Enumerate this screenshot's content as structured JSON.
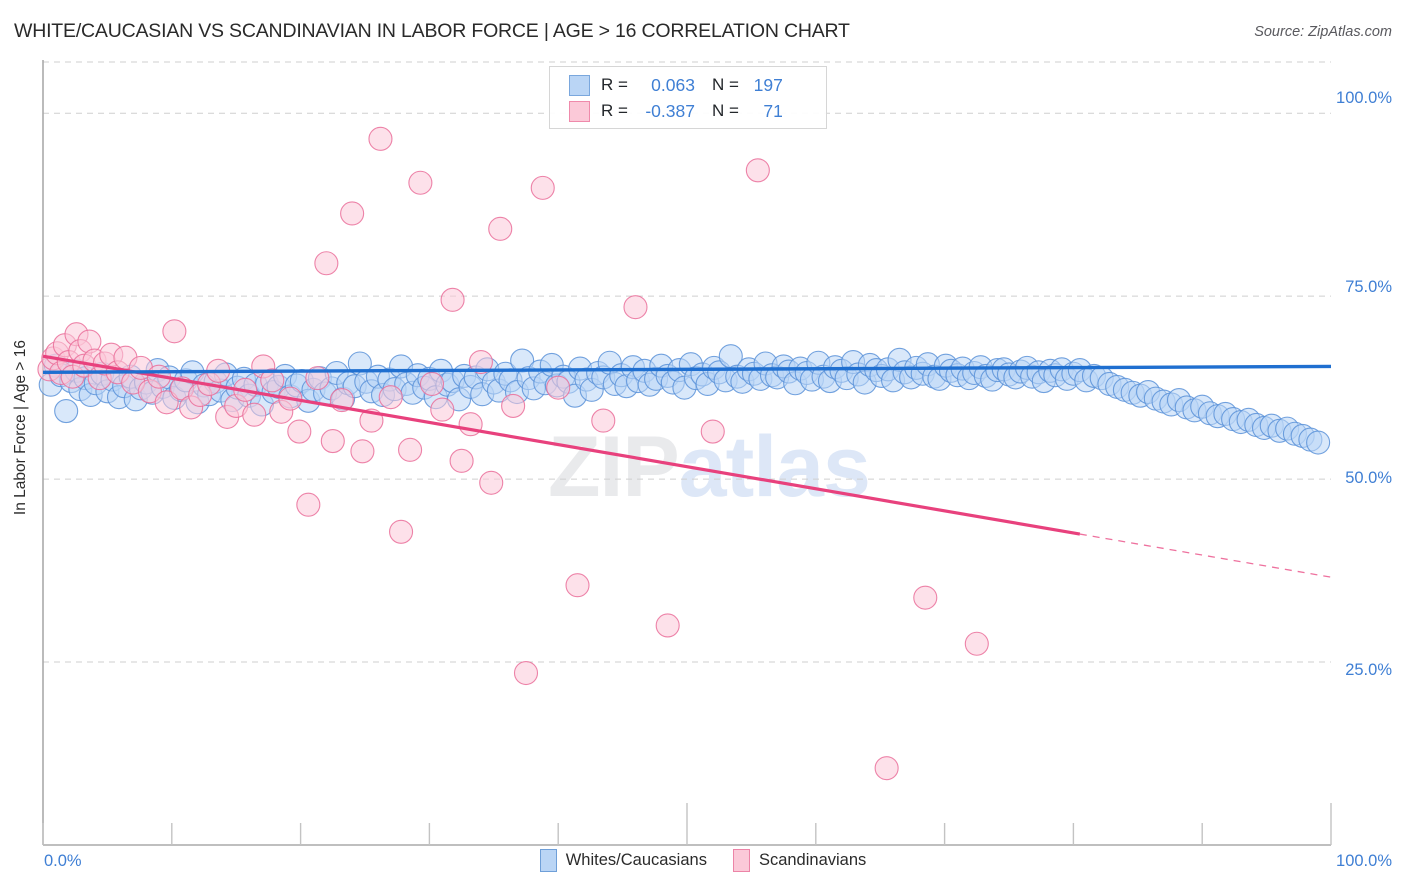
{
  "header": {
    "title": "WHITE/CAUCASIAN VS SCANDINAVIAN IN LABOR FORCE | AGE > 16 CORRELATION CHART",
    "source": "Source: ZipAtlas.com"
  },
  "watermark": {
    "part1": "ZIP",
    "part2": "atlas"
  },
  "stat_legend": {
    "rows": [
      {
        "series": "Whites/Caucasians",
        "color": "#bad5f5",
        "r_label": "R =",
        "r_value": "0.063",
        "n_label": "N =",
        "n_value": "197"
      },
      {
        "series": "Scandinavians",
        "color": "#fbc9d8",
        "r_label": "R =",
        "r_value": "-0.387",
        "n_label": "N =",
        "n_value": "71"
      }
    ]
  },
  "bottom_legend": {
    "items": [
      {
        "label": "Whites/Caucasians",
        "color": "#bad5f5"
      },
      {
        "label": "Scandinavians",
        "color": "#fbc9d8"
      }
    ]
  },
  "axes": {
    "y_title": "In Labor Force | Age > 16",
    "y_ticks": [
      "100.0%",
      "75.0%",
      "50.0%",
      "25.0%"
    ],
    "x_left": "0.0%",
    "x_right": "100.0%"
  },
  "chart_data": {
    "type": "scatter",
    "title": "WHITE/CAUCASIAN VS SCANDINAVIAN IN LABOR FORCE | AGE > 16 CORRELATION CHART",
    "xlabel": "",
    "ylabel": "In Labor Force | Age > 16",
    "xlim": [
      0,
      100
    ],
    "ylim": [
      0,
      107
    ],
    "grid": true,
    "legend_position": "bottom-center",
    "y_tick_values": [
      100,
      75,
      50,
      25
    ],
    "x_tick_values": [
      0,
      100
    ],
    "series": [
      {
        "name": "Whites/Caucasians",
        "color": "#bad5f5",
        "edge_color": "#5b92d8",
        "r": 0.063,
        "n": 197,
        "trend": {
          "type": "linear",
          "x0": 0,
          "y0": 64.6,
          "x1": 100,
          "y1": 65.4,
          "solid_to_x": 100
        },
        "points": [
          [
            0.6,
            62.9
          ],
          [
            1.0,
            65.5
          ],
          [
            1.4,
            64.2
          ],
          [
            1.8,
            59.3
          ],
          [
            2.2,
            63.4
          ],
          [
            2.6,
            64.8
          ],
          [
            2.9,
            62.3
          ],
          [
            3.3,
            63.8
          ],
          [
            3.7,
            61.5
          ],
          [
            4.1,
            63.1
          ],
          [
            4.6,
            64.4
          ],
          [
            5.0,
            62.0
          ],
          [
            5.4,
            63.6
          ],
          [
            5.9,
            61.2
          ],
          [
            6.3,
            62.7
          ],
          [
            6.8,
            64.0
          ],
          [
            7.2,
            60.9
          ],
          [
            7.6,
            62.4
          ],
          [
            8.0,
            63.2
          ],
          [
            8.5,
            61.8
          ],
          [
            8.9,
            64.9
          ],
          [
            9.3,
            62.6
          ],
          [
            9.8,
            63.9
          ],
          [
            10.2,
            61.1
          ],
          [
            10.7,
            62.2
          ],
          [
            11.1,
            63.5
          ],
          [
            11.6,
            64.6
          ],
          [
            12.0,
            60.5
          ],
          [
            12.5,
            62.8
          ],
          [
            12.9,
            61.6
          ],
          [
            13.4,
            63.3
          ],
          [
            13.8,
            62.1
          ],
          [
            14.2,
            64.3
          ],
          [
            14.7,
            60.8
          ],
          [
            15.1,
            62.5
          ],
          [
            15.6,
            63.7
          ],
          [
            16.0,
            61.4
          ],
          [
            16.5,
            62.9
          ],
          [
            17.0,
            60.2
          ],
          [
            17.4,
            63.0
          ],
          [
            17.9,
            61.9
          ],
          [
            18.3,
            62.6
          ],
          [
            18.8,
            64.1
          ],
          [
            19.2,
            61.3
          ],
          [
            19.7,
            62.8
          ],
          [
            20.1,
            63.4
          ],
          [
            20.6,
            60.7
          ],
          [
            21.0,
            62.2
          ],
          [
            21.5,
            63.8
          ],
          [
            21.9,
            61.7
          ],
          [
            22.4,
            62.4
          ],
          [
            22.8,
            64.5
          ],
          [
            23.3,
            61.0
          ],
          [
            23.7,
            63.1
          ],
          [
            24.2,
            62.7
          ],
          [
            24.6,
            65.8
          ],
          [
            25.1,
            63.3
          ],
          [
            25.5,
            62.0
          ],
          [
            26.0,
            64.0
          ],
          [
            26.4,
            61.5
          ],
          [
            26.9,
            63.6
          ],
          [
            27.3,
            62.3
          ],
          [
            27.8,
            65.4
          ],
          [
            28.2,
            63.0
          ],
          [
            28.7,
            61.8
          ],
          [
            29.1,
            64.2
          ],
          [
            29.6,
            62.5
          ],
          [
            30.0,
            63.7
          ],
          [
            30.5,
            61.2
          ],
          [
            30.9,
            64.8
          ],
          [
            31.4,
            62.9
          ],
          [
            31.8,
            63.4
          ],
          [
            32.3,
            60.9
          ],
          [
            32.7,
            64.1
          ],
          [
            33.2,
            62.6
          ],
          [
            33.6,
            63.9
          ],
          [
            34.1,
            61.6
          ],
          [
            34.5,
            65.0
          ],
          [
            35.0,
            63.2
          ],
          [
            35.4,
            62.1
          ],
          [
            35.9,
            64.4
          ],
          [
            36.3,
            63.5
          ],
          [
            36.8,
            61.9
          ],
          [
            37.2,
            66.2
          ],
          [
            37.7,
            63.8
          ],
          [
            38.1,
            62.4
          ],
          [
            38.6,
            64.7
          ],
          [
            39.0,
            63.1
          ],
          [
            39.5,
            65.6
          ],
          [
            39.9,
            62.8
          ],
          [
            40.4,
            64.0
          ],
          [
            40.8,
            63.3
          ],
          [
            41.3,
            61.4
          ],
          [
            41.7,
            65.1
          ],
          [
            42.2,
            63.6
          ],
          [
            42.6,
            62.2
          ],
          [
            43.1,
            64.5
          ],
          [
            43.5,
            63.9
          ],
          [
            44.0,
            65.9
          ],
          [
            44.4,
            63.0
          ],
          [
            44.9,
            64.2
          ],
          [
            45.3,
            62.7
          ],
          [
            45.8,
            65.3
          ],
          [
            46.2,
            63.4
          ],
          [
            46.7,
            64.8
          ],
          [
            47.1,
            62.9
          ],
          [
            47.6,
            63.7
          ],
          [
            48.0,
            65.5
          ],
          [
            48.5,
            64.1
          ],
          [
            48.9,
            63.2
          ],
          [
            49.4,
            64.9
          ],
          [
            49.8,
            62.5
          ],
          [
            50.3,
            65.7
          ],
          [
            50.7,
            63.8
          ],
          [
            51.2,
            64.3
          ],
          [
            51.6,
            63.0
          ],
          [
            52.1,
            65.2
          ],
          [
            52.5,
            64.6
          ],
          [
            53.0,
            63.5
          ],
          [
            53.4,
            66.8
          ],
          [
            53.9,
            64.0
          ],
          [
            54.3,
            63.3
          ],
          [
            54.8,
            65.0
          ],
          [
            55.2,
            64.4
          ],
          [
            55.7,
            63.7
          ],
          [
            56.1,
            65.8
          ],
          [
            56.6,
            64.2
          ],
          [
            57.0,
            63.9
          ],
          [
            57.5,
            65.4
          ],
          [
            57.9,
            64.7
          ],
          [
            58.4,
            63.1
          ],
          [
            58.8,
            65.1
          ],
          [
            59.3,
            64.5
          ],
          [
            59.7,
            63.6
          ],
          [
            60.2,
            65.9
          ],
          [
            60.6,
            64.0
          ],
          [
            61.1,
            63.4
          ],
          [
            61.5,
            65.3
          ],
          [
            62.0,
            64.8
          ],
          [
            62.4,
            63.8
          ],
          [
            62.9,
            66.0
          ],
          [
            63.3,
            64.3
          ],
          [
            63.8,
            63.2
          ],
          [
            64.2,
            65.6
          ],
          [
            64.7,
            64.9
          ],
          [
            65.1,
            64.1
          ],
          [
            65.6,
            65.0
          ],
          [
            66.0,
            63.5
          ],
          [
            66.5,
            66.3
          ],
          [
            66.9,
            64.6
          ],
          [
            67.4,
            63.9
          ],
          [
            67.8,
            65.2
          ],
          [
            68.3,
            64.4
          ],
          [
            68.7,
            65.7
          ],
          [
            69.2,
            64.0
          ],
          [
            69.6,
            63.7
          ],
          [
            70.1,
            65.5
          ],
          [
            70.5,
            64.8
          ],
          [
            71.0,
            64.2
          ],
          [
            71.4,
            65.1
          ],
          [
            71.9,
            63.8
          ],
          [
            72.3,
            64.5
          ],
          [
            72.8,
            65.3
          ],
          [
            73.2,
            64.1
          ],
          [
            73.7,
            63.6
          ],
          [
            74.1,
            64.9
          ],
          [
            74.6,
            65.0
          ],
          [
            75.0,
            64.3
          ],
          [
            75.5,
            63.9
          ],
          [
            75.9,
            64.7
          ],
          [
            76.4,
            65.2
          ],
          [
            76.8,
            64.0
          ],
          [
            77.3,
            64.6
          ],
          [
            77.7,
            63.4
          ],
          [
            78.2,
            64.8
          ],
          [
            78.6,
            64.2
          ],
          [
            79.1,
            65.0
          ],
          [
            79.5,
            63.7
          ],
          [
            80.0,
            64.4
          ],
          [
            80.5,
            64.9
          ],
          [
            81.0,
            63.5
          ],
          [
            81.6,
            64.1
          ],
          [
            82.2,
            63.8
          ],
          [
            82.8,
            63.0
          ],
          [
            83.4,
            62.6
          ],
          [
            84.0,
            62.2
          ],
          [
            84.6,
            61.8
          ],
          [
            85.2,
            61.4
          ],
          [
            85.8,
            61.9
          ],
          [
            86.4,
            61.0
          ],
          [
            87.0,
            60.6
          ],
          [
            87.6,
            60.2
          ],
          [
            88.2,
            60.8
          ],
          [
            88.8,
            59.8
          ],
          [
            89.4,
            59.4
          ],
          [
            90.0,
            59.9
          ],
          [
            90.6,
            59.0
          ],
          [
            91.2,
            58.6
          ],
          [
            91.8,
            58.9
          ],
          [
            92.4,
            58.2
          ],
          [
            93.0,
            57.8
          ],
          [
            93.6,
            58.1
          ],
          [
            94.2,
            57.4
          ],
          [
            94.8,
            57.0
          ],
          [
            95.4,
            57.3
          ],
          [
            96.0,
            56.6
          ],
          [
            96.6,
            56.9
          ],
          [
            97.2,
            56.2
          ],
          [
            97.8,
            55.9
          ],
          [
            98.4,
            55.4
          ],
          [
            99.0,
            55.0
          ]
        ]
      },
      {
        "name": "Scandinavians",
        "color": "#fbc9d8",
        "edge_color": "#ea6e9a",
        "r": -0.387,
        "n": 71,
        "trend": {
          "type": "linear",
          "x0": 0,
          "y0": 66.8,
          "x1": 100,
          "y1": 36.6,
          "solid_to_x": 80.5
        },
        "points": [
          [
            0.5,
            65.0
          ],
          [
            0.8,
            66.5
          ],
          [
            1.1,
            67.2
          ],
          [
            1.4,
            64.5
          ],
          [
            1.7,
            68.3
          ],
          [
            2.0,
            66.0
          ],
          [
            2.3,
            64.0
          ],
          [
            2.6,
            69.8
          ],
          [
            2.9,
            67.5
          ],
          [
            3.2,
            65.5
          ],
          [
            3.6,
            68.8
          ],
          [
            4.0,
            66.2
          ],
          [
            4.4,
            63.8
          ],
          [
            4.8,
            65.8
          ],
          [
            5.3,
            67.0
          ],
          [
            5.8,
            64.6
          ],
          [
            6.4,
            66.6
          ],
          [
            7.0,
            63.2
          ],
          [
            7.6,
            65.2
          ],
          [
            8.3,
            62.0
          ],
          [
            9.0,
            64.0
          ],
          [
            9.6,
            60.5
          ],
          [
            10.2,
            70.2
          ],
          [
            10.8,
            62.4
          ],
          [
            11.5,
            59.8
          ],
          [
            12.2,
            61.5
          ],
          [
            12.9,
            63.0
          ],
          [
            13.6,
            64.8
          ],
          [
            14.3,
            58.5
          ],
          [
            15.0,
            60.0
          ],
          [
            15.7,
            62.2
          ],
          [
            16.4,
            58.8
          ],
          [
            17.1,
            65.4
          ],
          [
            17.8,
            63.5
          ],
          [
            18.5,
            59.2
          ],
          [
            19.2,
            61.0
          ],
          [
            19.9,
            56.5
          ],
          [
            20.6,
            46.5
          ],
          [
            21.3,
            63.8
          ],
          [
            22.0,
            79.5
          ],
          [
            22.5,
            55.2
          ],
          [
            23.2,
            60.8
          ],
          [
            24.0,
            86.3
          ],
          [
            24.8,
            53.8
          ],
          [
            25.5,
            58.0
          ],
          [
            26.2,
            96.5
          ],
          [
            27.0,
            61.2
          ],
          [
            27.8,
            42.8
          ],
          [
            28.5,
            54.0
          ],
          [
            29.3,
            90.5
          ],
          [
            30.2,
            63.0
          ],
          [
            31.0,
            59.5
          ],
          [
            31.8,
            74.5
          ],
          [
            32.5,
            52.5
          ],
          [
            33.2,
            57.5
          ],
          [
            34.0,
            66.0
          ],
          [
            34.8,
            49.5
          ],
          [
            35.5,
            84.2
          ],
          [
            36.5,
            60.0
          ],
          [
            37.5,
            23.5
          ],
          [
            38.8,
            89.8
          ],
          [
            40.0,
            62.5
          ],
          [
            41.5,
            35.5
          ],
          [
            43.5,
            58.0
          ],
          [
            46.0,
            73.5
          ],
          [
            48.5,
            30.0
          ],
          [
            52.0,
            56.5
          ],
          [
            55.5,
            92.2
          ],
          [
            65.5,
            10.5
          ],
          [
            68.5,
            33.8
          ],
          [
            72.5,
            27.5
          ]
        ]
      }
    ]
  }
}
